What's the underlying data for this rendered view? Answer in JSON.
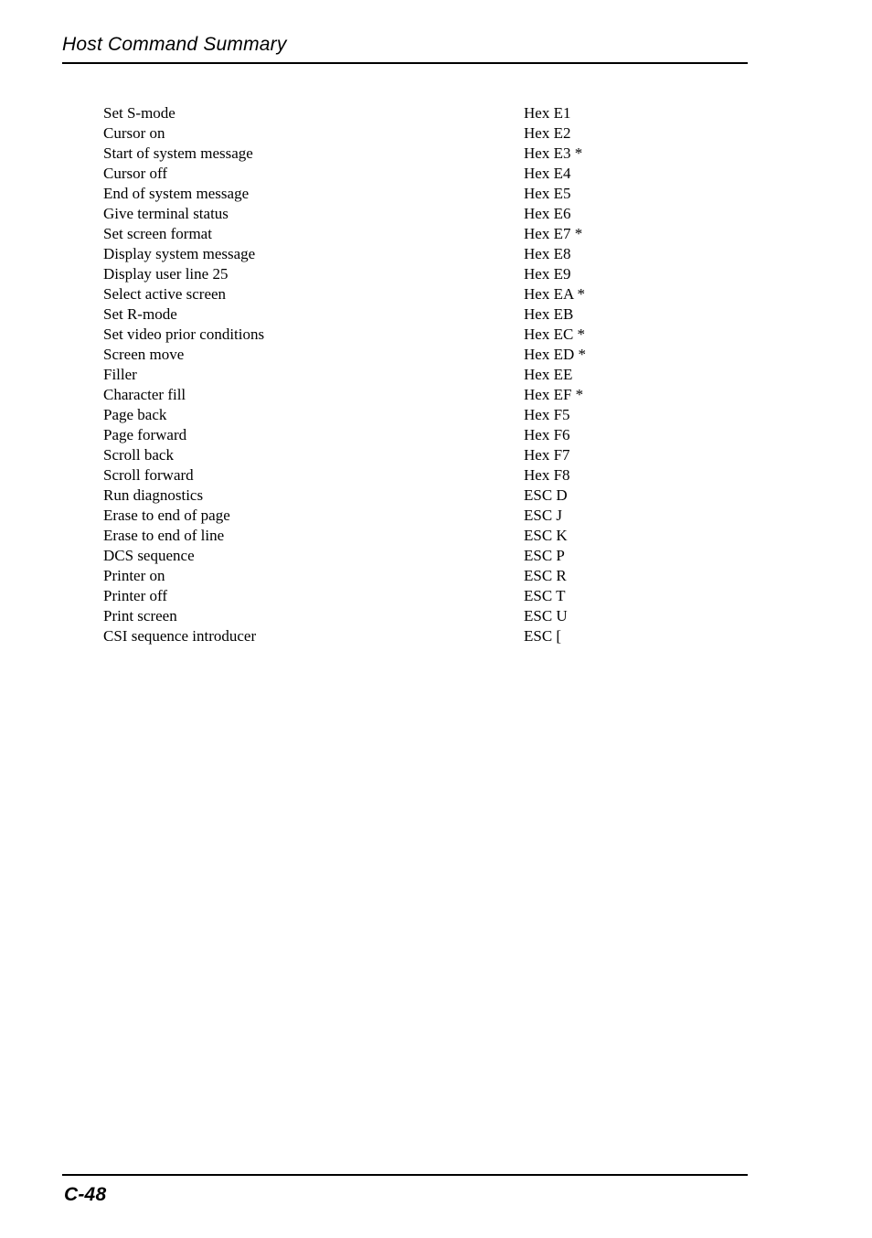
{
  "header": {
    "title": "Host Command Summary"
  },
  "commands": {
    "rows": [
      {
        "name": "Set S-mode",
        "code": "Hex E1"
      },
      {
        "name": "Cursor on",
        "code": "Hex E2"
      },
      {
        "name": "Start of system message",
        "code": "Hex E3 *"
      },
      {
        "name": "Cursor off",
        "code": "Hex E4"
      },
      {
        "name": "End of system message",
        "code": "Hex E5"
      },
      {
        "name": "Give terminal status",
        "code": "Hex E6"
      },
      {
        "name": "Set screen format",
        "code": "Hex E7 *"
      },
      {
        "name": "Display system message",
        "code": "Hex E8"
      },
      {
        "name": "Display user line 25",
        "code": "Hex E9"
      },
      {
        "name": "Select active screen",
        "code": "Hex EA *"
      },
      {
        "name": "Set R-mode",
        "code": "Hex EB"
      },
      {
        "name": "Set video prior conditions",
        "code": "Hex EC *"
      },
      {
        "name": "Screen move",
        "code": "Hex ED *"
      },
      {
        "name": "Filler",
        "code": "Hex EE"
      },
      {
        "name": "Character fill",
        "code": "Hex EF *"
      },
      {
        "name": "Page back",
        "code": "Hex F5"
      },
      {
        "name": "Page forward",
        "code": "Hex F6"
      },
      {
        "name": "Scroll back",
        "code": "Hex F7"
      },
      {
        "name": "Scroll forward",
        "code": "Hex F8"
      },
      {
        "name": "Run diagnostics",
        "code": "ESC D"
      },
      {
        "name": "Erase to end of page",
        "code": "ESC J"
      },
      {
        "name": "Erase to end of line",
        "code": "ESC K"
      },
      {
        "name": "DCS sequence",
        "code": "ESC P"
      },
      {
        "name": "Printer on",
        "code": "ESC R"
      },
      {
        "name": "Printer off",
        "code": "ESC T"
      },
      {
        "name": "Print screen",
        "code": "ESC U"
      },
      {
        "name": "CSI sequence introducer",
        "code": "ESC ["
      }
    ]
  },
  "footer": {
    "page_number": "C-48"
  }
}
